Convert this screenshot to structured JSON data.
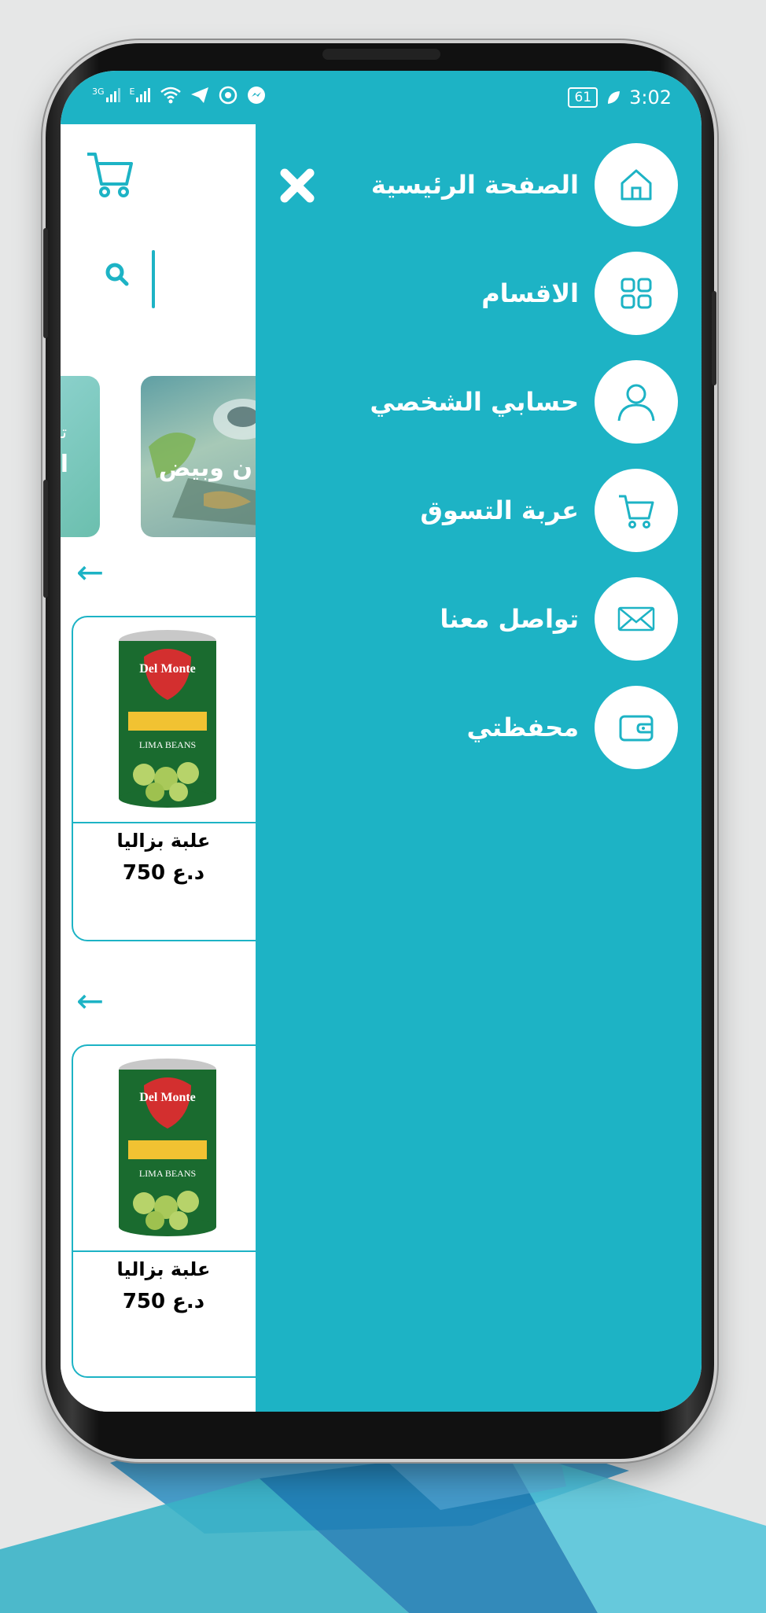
{
  "status_bar": {
    "network_labels": [
      "3G",
      "E"
    ],
    "battery": "61",
    "time": "3:02"
  },
  "app": {
    "cart_icon": "cart-icon",
    "search_icon": "search-icon",
    "banners": [
      {
        "line1": "تس",
        "line2": "اد"
      },
      {
        "title": "ن وبيض"
      }
    ],
    "products": [
      {
        "name": "علبة بزاليا",
        "price": "750 د.ع"
      },
      {
        "name": "علبة بزاليا",
        "price": "750 د.ع"
      }
    ]
  },
  "drawer": {
    "close_icon": "close-icon",
    "items": [
      {
        "label": "الصفحة الرئيسية",
        "icon": "home-icon"
      },
      {
        "label": "الاقسام",
        "icon": "grid-icon"
      },
      {
        "label": "حسابي الشخصي",
        "icon": "user-icon"
      },
      {
        "label": "عربة التسوق",
        "icon": "cart-icon"
      },
      {
        "label": "تواصل معنا",
        "icon": "mail-icon"
      },
      {
        "label": "محفظتي",
        "icon": "wallet-icon"
      }
    ]
  },
  "colors": {
    "accent": "#1db3c5",
    "background": "#e6e7e7"
  }
}
